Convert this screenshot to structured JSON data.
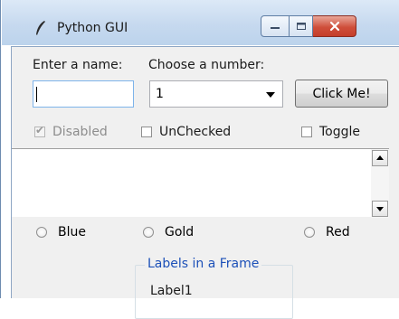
{
  "window": {
    "title": "Python GUI",
    "icon": "feather-icon",
    "controls": [
      "minimize-icon",
      "maximize-icon",
      "close-icon"
    ]
  },
  "form": {
    "name_label": "Enter a name:",
    "name_value": "",
    "number_label": "Choose a number:",
    "number_value": "1",
    "button_label": "Click Me!"
  },
  "checkboxes": [
    {
      "label": "Disabled",
      "checked": true,
      "disabled": true
    },
    {
      "label": "UnChecked",
      "checked": false,
      "disabled": false
    },
    {
      "label": "Toggle",
      "checked": false,
      "disabled": false
    }
  ],
  "text_area": {
    "value": ""
  },
  "radios": [
    {
      "label": "Blue"
    },
    {
      "label": "Gold"
    },
    {
      "label": "Red"
    }
  ],
  "label_frame": {
    "title": "Labels in a Frame",
    "labels": [
      "Label1"
    ]
  },
  "colors": {
    "frame_title": "#1c50b8",
    "close_button": "#c53d2a",
    "background": "#f0f0f0"
  }
}
